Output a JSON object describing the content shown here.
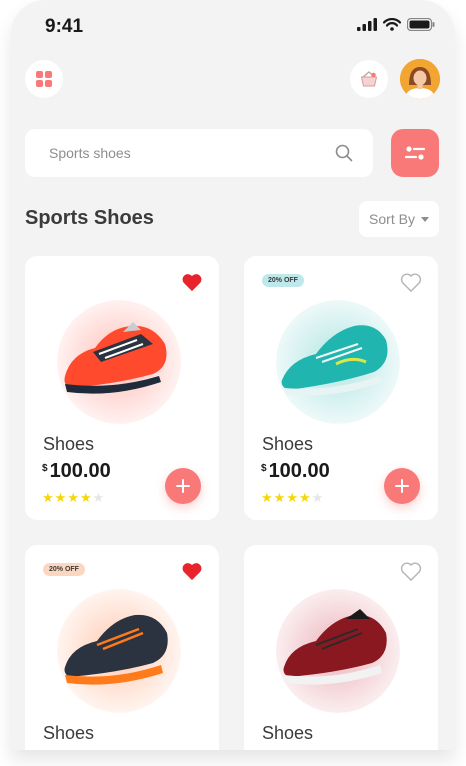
{
  "status_bar": {
    "time": "9:41"
  },
  "search": {
    "placeholder": "Sports shoes"
  },
  "section": {
    "title": "Sports Shoes",
    "sort_label": "Sort By"
  },
  "colors": {
    "accent": "#f97878",
    "heart": "#e8232c",
    "star": "#f5d800",
    "background": "#f3f3f3"
  },
  "products": [
    {
      "name": "Shoes",
      "currency": "$",
      "price": "100.00",
      "rating": 4,
      "liked": true,
      "discount": "",
      "color": "#ff4a2e"
    },
    {
      "name": "Shoes",
      "currency": "$",
      "price": "100.00",
      "rating": 4,
      "liked": false,
      "discount": "20% OFF",
      "color": "#21b5b0"
    },
    {
      "name": "Shoes",
      "liked": true,
      "discount": "20% OFF",
      "color": "#2b3340"
    },
    {
      "name": "Shoes",
      "liked": false,
      "discount": "",
      "color": "#8a1820"
    }
  ]
}
